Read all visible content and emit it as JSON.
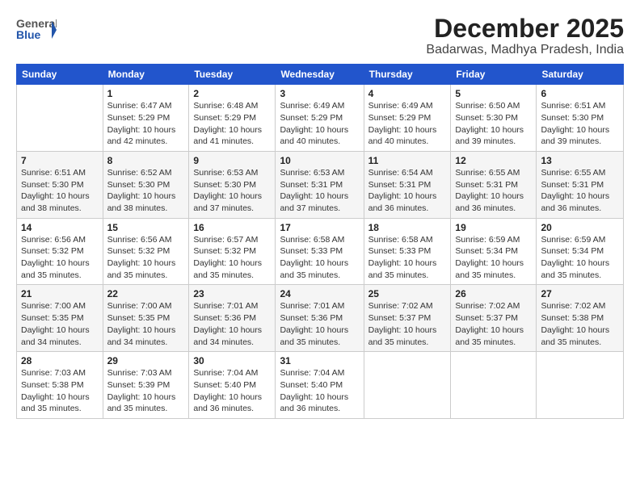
{
  "logo": {
    "general": "General",
    "blue": "Blue"
  },
  "header": {
    "month": "December 2025",
    "location": "Badarwas, Madhya Pradesh, India"
  },
  "weekdays": [
    "Sunday",
    "Monday",
    "Tuesday",
    "Wednesday",
    "Thursday",
    "Friday",
    "Saturday"
  ],
  "weeks": [
    [
      {
        "day": "",
        "info": ""
      },
      {
        "day": "1",
        "info": "Sunrise: 6:47 AM\nSunset: 5:29 PM\nDaylight: 10 hours\nand 42 minutes."
      },
      {
        "day": "2",
        "info": "Sunrise: 6:48 AM\nSunset: 5:29 PM\nDaylight: 10 hours\nand 41 minutes."
      },
      {
        "day": "3",
        "info": "Sunrise: 6:49 AM\nSunset: 5:29 PM\nDaylight: 10 hours\nand 40 minutes."
      },
      {
        "day": "4",
        "info": "Sunrise: 6:49 AM\nSunset: 5:29 PM\nDaylight: 10 hours\nand 40 minutes."
      },
      {
        "day": "5",
        "info": "Sunrise: 6:50 AM\nSunset: 5:30 PM\nDaylight: 10 hours\nand 39 minutes."
      },
      {
        "day": "6",
        "info": "Sunrise: 6:51 AM\nSunset: 5:30 PM\nDaylight: 10 hours\nand 39 minutes."
      }
    ],
    [
      {
        "day": "7",
        "info": "Sunrise: 6:51 AM\nSunset: 5:30 PM\nDaylight: 10 hours\nand 38 minutes."
      },
      {
        "day": "8",
        "info": "Sunrise: 6:52 AM\nSunset: 5:30 PM\nDaylight: 10 hours\nand 38 minutes."
      },
      {
        "day": "9",
        "info": "Sunrise: 6:53 AM\nSunset: 5:30 PM\nDaylight: 10 hours\nand 37 minutes."
      },
      {
        "day": "10",
        "info": "Sunrise: 6:53 AM\nSunset: 5:31 PM\nDaylight: 10 hours\nand 37 minutes."
      },
      {
        "day": "11",
        "info": "Sunrise: 6:54 AM\nSunset: 5:31 PM\nDaylight: 10 hours\nand 36 minutes."
      },
      {
        "day": "12",
        "info": "Sunrise: 6:55 AM\nSunset: 5:31 PM\nDaylight: 10 hours\nand 36 minutes."
      },
      {
        "day": "13",
        "info": "Sunrise: 6:55 AM\nSunset: 5:31 PM\nDaylight: 10 hours\nand 36 minutes."
      }
    ],
    [
      {
        "day": "14",
        "info": "Sunrise: 6:56 AM\nSunset: 5:32 PM\nDaylight: 10 hours\nand 35 minutes."
      },
      {
        "day": "15",
        "info": "Sunrise: 6:56 AM\nSunset: 5:32 PM\nDaylight: 10 hours\nand 35 minutes."
      },
      {
        "day": "16",
        "info": "Sunrise: 6:57 AM\nSunset: 5:32 PM\nDaylight: 10 hours\nand 35 minutes."
      },
      {
        "day": "17",
        "info": "Sunrise: 6:58 AM\nSunset: 5:33 PM\nDaylight: 10 hours\nand 35 minutes."
      },
      {
        "day": "18",
        "info": "Sunrise: 6:58 AM\nSunset: 5:33 PM\nDaylight: 10 hours\nand 35 minutes."
      },
      {
        "day": "19",
        "info": "Sunrise: 6:59 AM\nSunset: 5:34 PM\nDaylight: 10 hours\nand 35 minutes."
      },
      {
        "day": "20",
        "info": "Sunrise: 6:59 AM\nSunset: 5:34 PM\nDaylight: 10 hours\nand 35 minutes."
      }
    ],
    [
      {
        "day": "21",
        "info": "Sunrise: 7:00 AM\nSunset: 5:35 PM\nDaylight: 10 hours\nand 34 minutes."
      },
      {
        "day": "22",
        "info": "Sunrise: 7:00 AM\nSunset: 5:35 PM\nDaylight: 10 hours\nand 34 minutes."
      },
      {
        "day": "23",
        "info": "Sunrise: 7:01 AM\nSunset: 5:36 PM\nDaylight: 10 hours\nand 34 minutes."
      },
      {
        "day": "24",
        "info": "Sunrise: 7:01 AM\nSunset: 5:36 PM\nDaylight: 10 hours\nand 35 minutes."
      },
      {
        "day": "25",
        "info": "Sunrise: 7:02 AM\nSunset: 5:37 PM\nDaylight: 10 hours\nand 35 minutes."
      },
      {
        "day": "26",
        "info": "Sunrise: 7:02 AM\nSunset: 5:37 PM\nDaylight: 10 hours\nand 35 minutes."
      },
      {
        "day": "27",
        "info": "Sunrise: 7:02 AM\nSunset: 5:38 PM\nDaylight: 10 hours\nand 35 minutes."
      }
    ],
    [
      {
        "day": "28",
        "info": "Sunrise: 7:03 AM\nSunset: 5:38 PM\nDaylight: 10 hours\nand 35 minutes."
      },
      {
        "day": "29",
        "info": "Sunrise: 7:03 AM\nSunset: 5:39 PM\nDaylight: 10 hours\nand 35 minutes."
      },
      {
        "day": "30",
        "info": "Sunrise: 7:04 AM\nSunset: 5:40 PM\nDaylight: 10 hours\nand 36 minutes."
      },
      {
        "day": "31",
        "info": "Sunrise: 7:04 AM\nSunset: 5:40 PM\nDaylight: 10 hours\nand 36 minutes."
      },
      {
        "day": "",
        "info": ""
      },
      {
        "day": "",
        "info": ""
      },
      {
        "day": "",
        "info": ""
      }
    ]
  ]
}
